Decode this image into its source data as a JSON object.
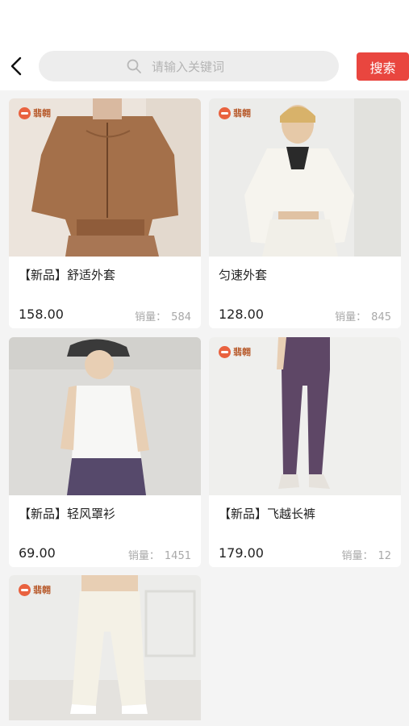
{
  "search": {
    "placeholder": "请输入关键词",
    "button_label": "搜索"
  },
  "icons": {
    "back": "back-arrow-icon",
    "search": "search-icon",
    "brand": "brand-logo-icon"
  },
  "colors": {
    "accent": "#e9463f",
    "background": "#f4f4f4"
  },
  "products": [
    {
      "brand": "翡翱",
      "title": "【新品】舒适外套",
      "price": "158.00",
      "sales_label": "销量：",
      "sales": "584"
    },
    {
      "brand": "翡翱",
      "title": "匀速外套",
      "price": "128.00",
      "sales_label": "销量：",
      "sales": "845"
    },
    {
      "brand": "",
      "title": "【新品】轻风罩衫",
      "price": "69.00",
      "sales_label": "销量：",
      "sales": "1451"
    },
    {
      "brand": "翡翱",
      "title": "【新品】飞越长裤",
      "price": "179.00",
      "sales_label": "销量：",
      "sales": "12"
    },
    {
      "brand": "翡翱",
      "title": "",
      "price": "",
      "sales_label": "",
      "sales": ""
    }
  ]
}
